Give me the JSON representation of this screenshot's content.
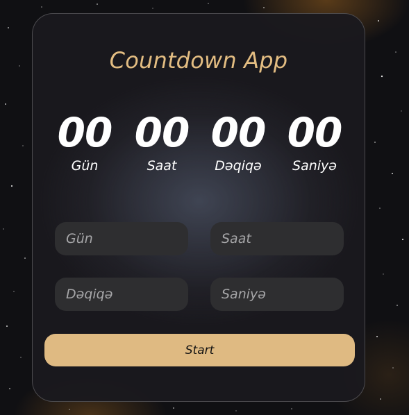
{
  "app": {
    "title": "Countdown App"
  },
  "timer": [
    {
      "value": "00",
      "label": "Gün"
    },
    {
      "value": "00",
      "label": "Saat"
    },
    {
      "value": "00",
      "label": "Dəqiqə"
    },
    {
      "value": "00",
      "label": "Saniyə"
    }
  ],
  "inputs": {
    "days": {
      "placeholder": "Gün",
      "value": ""
    },
    "hours": {
      "placeholder": "Saat",
      "value": ""
    },
    "minutes": {
      "placeholder": "Dəqiqə",
      "value": ""
    },
    "seconds": {
      "placeholder": "Saniyə",
      "value": ""
    }
  },
  "button": {
    "start_label": "Start"
  },
  "colors": {
    "accent": "#dfba82",
    "title": "#e3bd82",
    "card_bg": "#1a191e",
    "input_bg": "#2e2e30",
    "page_bg": "#101013"
  }
}
